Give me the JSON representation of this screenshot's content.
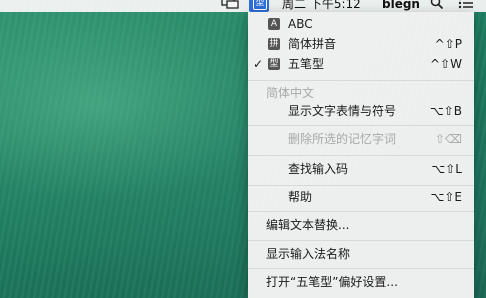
{
  "menubar": {
    "clock": "周二 下午5:12",
    "user": "blegn",
    "input_source_glyph": "型"
  },
  "menu": {
    "sources": [
      {
        "badge": "A",
        "label": "ABC",
        "shortcut": "",
        "checked": false
      },
      {
        "badge": "拼",
        "label": "简体拼音",
        "shortcut": "^⇧P",
        "checked": false
      },
      {
        "badge": "型",
        "label": "五笔型",
        "shortcut": "^⇧W",
        "checked": true
      }
    ],
    "check_glyph": "✓",
    "section_header": "简体中文",
    "section_items": [
      {
        "label": "显示文字表情与符号",
        "shortcut": "⌥⇧B",
        "disabled": false
      },
      {
        "label": "删除所选的记忆字词",
        "shortcut": "⇧⌫",
        "disabled": true
      },
      {
        "label": "查找输入码",
        "shortcut": "⌥⇧L",
        "disabled": false
      },
      {
        "label": "帮助",
        "shortcut": "⌥⇧E",
        "disabled": false
      }
    ],
    "edit_replacements": "编辑文本替换...",
    "show_input_name": "显示输入法名称",
    "open_prefs": "打开“五笔型”偏好设置..."
  },
  "colors": {
    "menubar_bg": "#f5f5f5",
    "selected_icon_bg": "#2f6fd8",
    "menu_bg": "#f2f2f2",
    "disabled_text": "#a8a8a8"
  }
}
